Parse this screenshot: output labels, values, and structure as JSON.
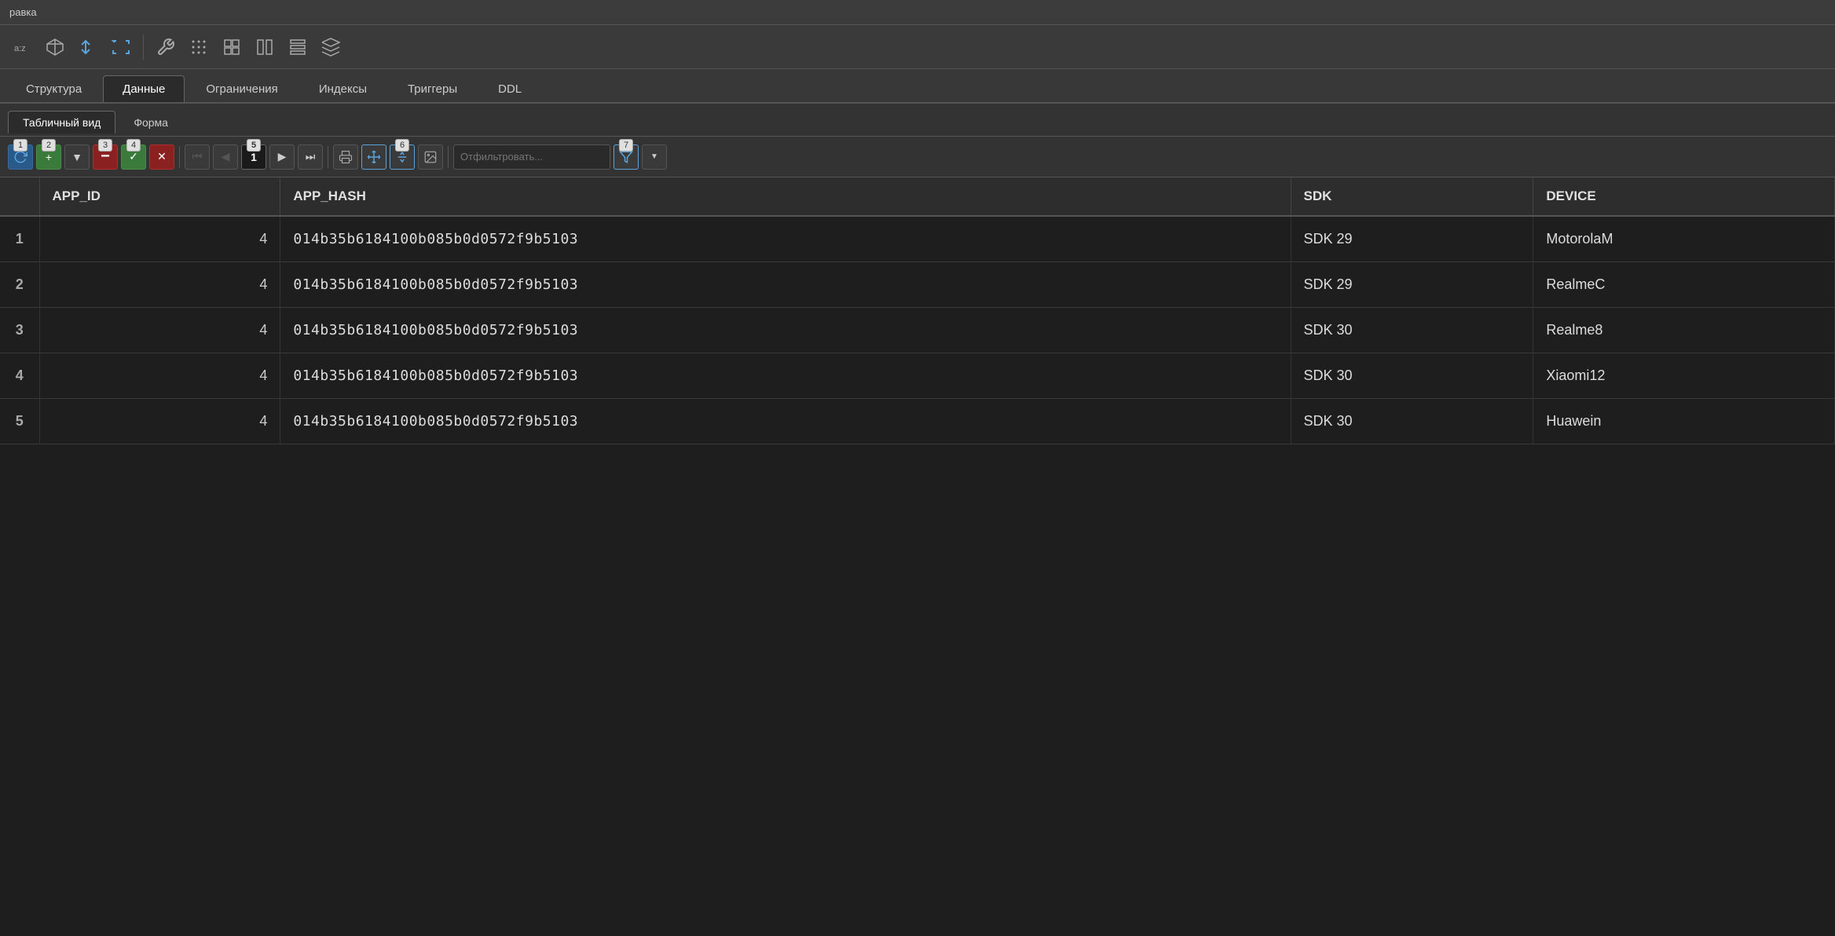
{
  "titlebar": {
    "text": "равка"
  },
  "toolbar": {
    "icons": [
      {
        "name": "az-icon",
        "symbol": "az",
        "type": "gray"
      },
      {
        "name": "cube-icon",
        "symbol": "cube",
        "type": "gray"
      },
      {
        "name": "collapse-icon",
        "symbol": "collapse",
        "type": "blue"
      },
      {
        "name": "expand-icon",
        "symbol": "expand",
        "type": "blue"
      },
      {
        "name": "wrench-icon",
        "symbol": "wrench",
        "type": "gray"
      },
      {
        "name": "grid1-icon",
        "symbol": "grid1",
        "type": "gray"
      },
      {
        "name": "grid2-icon",
        "symbol": "grid2",
        "type": "gray"
      },
      {
        "name": "columns-icon",
        "symbol": "columns",
        "type": "gray"
      },
      {
        "name": "rows-icon",
        "symbol": "rows",
        "type": "gray"
      },
      {
        "name": "layers-icon",
        "symbol": "layers",
        "type": "gray"
      }
    ]
  },
  "tabs": {
    "items": [
      {
        "label": "Структура",
        "active": false
      },
      {
        "label": "Данные",
        "active": true
      },
      {
        "label": "Ограничения",
        "active": false
      },
      {
        "label": "Индексы",
        "active": false
      },
      {
        "label": "Триггеры",
        "active": false
      },
      {
        "label": "DDL",
        "active": false
      }
    ]
  },
  "subtabs": {
    "items": [
      {
        "label": "Табличный вид",
        "active": true
      },
      {
        "label": "Форма",
        "active": false
      }
    ]
  },
  "data_toolbar": {
    "refresh_label": "↻",
    "add_label": "+",
    "add_dropdown_label": "▼",
    "delete_label": "−",
    "confirm_label": "✓",
    "cancel_label": "✕",
    "first_label": "⏮",
    "prev_label": "◀",
    "current_page": "1",
    "next_label": "▶",
    "last_label": "⏭",
    "print_label": "🖨",
    "filter_placeholder": "Отфильтровать...",
    "badges": {
      "b1": "1",
      "b2": "2",
      "b3": "3",
      "b4": "4",
      "b5": "5",
      "b6": "6",
      "b7": "7"
    }
  },
  "table": {
    "columns": [
      "",
      "APP_ID",
      "APP_HASH",
      "SDK",
      "DEVICE"
    ],
    "rows": [
      {
        "row_num": "1",
        "app_id": "4",
        "app_hash": "014b35b6184100b085b0d0572f9b5103",
        "sdk": "SDK 29",
        "device": "MotorolaM"
      },
      {
        "row_num": "2",
        "app_id": "4",
        "app_hash": "014b35b6184100b085b0d0572f9b5103",
        "sdk": "SDK 29",
        "device": "RealmeC"
      },
      {
        "row_num": "3",
        "app_id": "4",
        "app_hash": "014b35b6184100b085b0d0572f9b5103",
        "sdk": "SDK 30",
        "device": "Realme8"
      },
      {
        "row_num": "4",
        "app_id": "4",
        "app_hash": "014b35b6184100b085b0d0572f9b5103",
        "sdk": "SDK 30",
        "device": "Xiaomi12"
      },
      {
        "row_num": "5",
        "app_id": "4",
        "app_hash": "014b35b6184100b085b0d0572f9b5103",
        "sdk": "SDK 30",
        "device": "Huawein"
      }
    ]
  }
}
